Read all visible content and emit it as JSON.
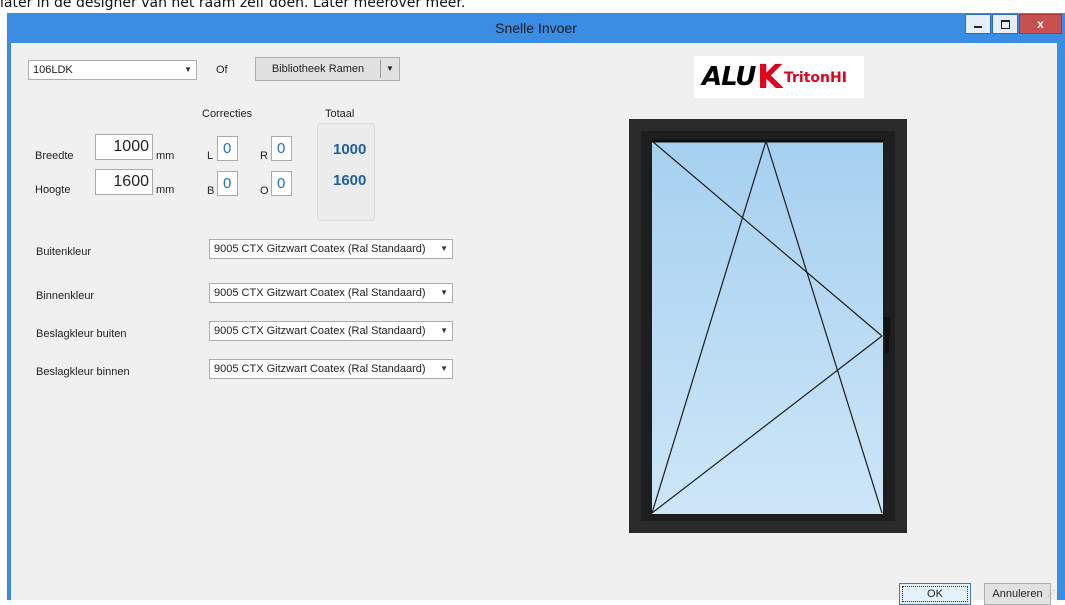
{
  "background_text": "later in de designer van het raam zelf doen. Later meerover meer.",
  "window": {
    "title": "Snelle Invoer",
    "controls": {
      "minimize": "—",
      "maximize": "□",
      "close": "x"
    }
  },
  "profile": {
    "selected": "106LDK",
    "or_label": "Of",
    "library_button": "Bibliotheek Ramen"
  },
  "dimensions": {
    "width_label": "Breedte",
    "height_label": "Hoogte",
    "width_value": "1000",
    "height_value": "1600",
    "unit": "mm"
  },
  "corrections": {
    "header": "Correcties",
    "L_label": "L",
    "L_value": "0",
    "R_label": "R",
    "R_value": "0",
    "B_label": "B",
    "B_value": "0",
    "O_label": "O",
    "O_value": "0"
  },
  "totals": {
    "header": "Totaal",
    "width": "1000",
    "height": "1600"
  },
  "colors": [
    {
      "label": "Buitenkleur",
      "value": "9005 CTX Gitzwart Coatex (Ral Standaard)"
    },
    {
      "label": "Binnenkleur",
      "value": "9005 CTX Gitzwart Coatex (Ral Standaard)"
    },
    {
      "label": "Beslagkleur buiten",
      "value": "9005 CTX Gitzwart Coatex (Ral Standaard)"
    },
    {
      "label": "Beslagkleur binnen",
      "value": "9005 CTX Gitzwart Coatex (Ral Standaard)"
    }
  ],
  "logo": {
    "brand_left": "ALU",
    "brand_k": "K",
    "brand_right": "TritonHI"
  },
  "buttons": {
    "ok": "OK",
    "cancel": "Annuleren"
  },
  "theme": {
    "accent": "#3b8de3",
    "frame": "#2b2b2b",
    "glass": "#b9dcf5",
    "logo_red": "#e2001a"
  }
}
